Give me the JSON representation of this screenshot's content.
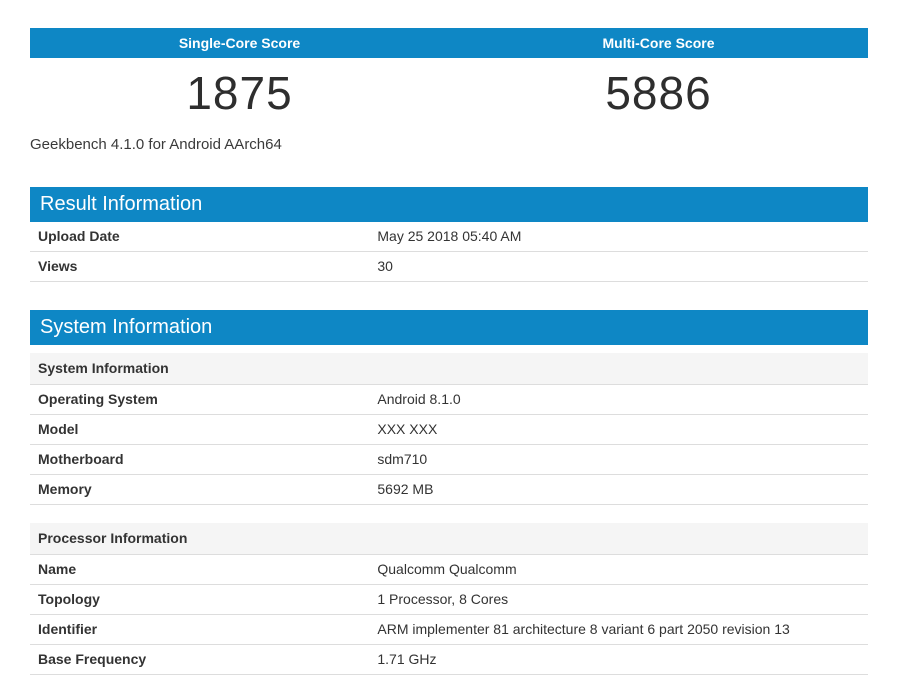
{
  "colors": {
    "accent_blue": "#0e87c5",
    "row_border": "#dddddd",
    "subheader_bg": "#f5f5f5",
    "text": "#333333"
  },
  "scores": {
    "single_core": {
      "label": "Single-Core Score",
      "value": "1875"
    },
    "multi_core": {
      "label": "Multi-Core Score",
      "value": "5886"
    },
    "caption": "Geekbench 4.1.0 for Android AArch64"
  },
  "result_information": {
    "title": "Result Information",
    "rows": [
      {
        "label": "Upload Date",
        "value": "May 25 2018 05:40 AM"
      },
      {
        "label": "Views",
        "value": "30"
      }
    ]
  },
  "system_information": {
    "title": "System Information",
    "groups": [
      {
        "heading": "System Information",
        "rows": [
          {
            "label": "Operating System",
            "value": "Android 8.1.0"
          },
          {
            "label": "Model",
            "value": "XXX XXX"
          },
          {
            "label": "Motherboard",
            "value": "sdm710"
          },
          {
            "label": "Memory",
            "value": "5692 MB"
          }
        ]
      },
      {
        "heading": "Processor Information",
        "rows": [
          {
            "label": "Name",
            "value": "Qualcomm Qualcomm"
          },
          {
            "label": "Topology",
            "value": "1 Processor, 8 Cores"
          },
          {
            "label": "Identifier",
            "value": "ARM implementer 81 architecture 8 variant 6 part 2050 revision 13"
          },
          {
            "label": "Base Frequency",
            "value": "1.71 GHz"
          }
        ]
      }
    ]
  }
}
